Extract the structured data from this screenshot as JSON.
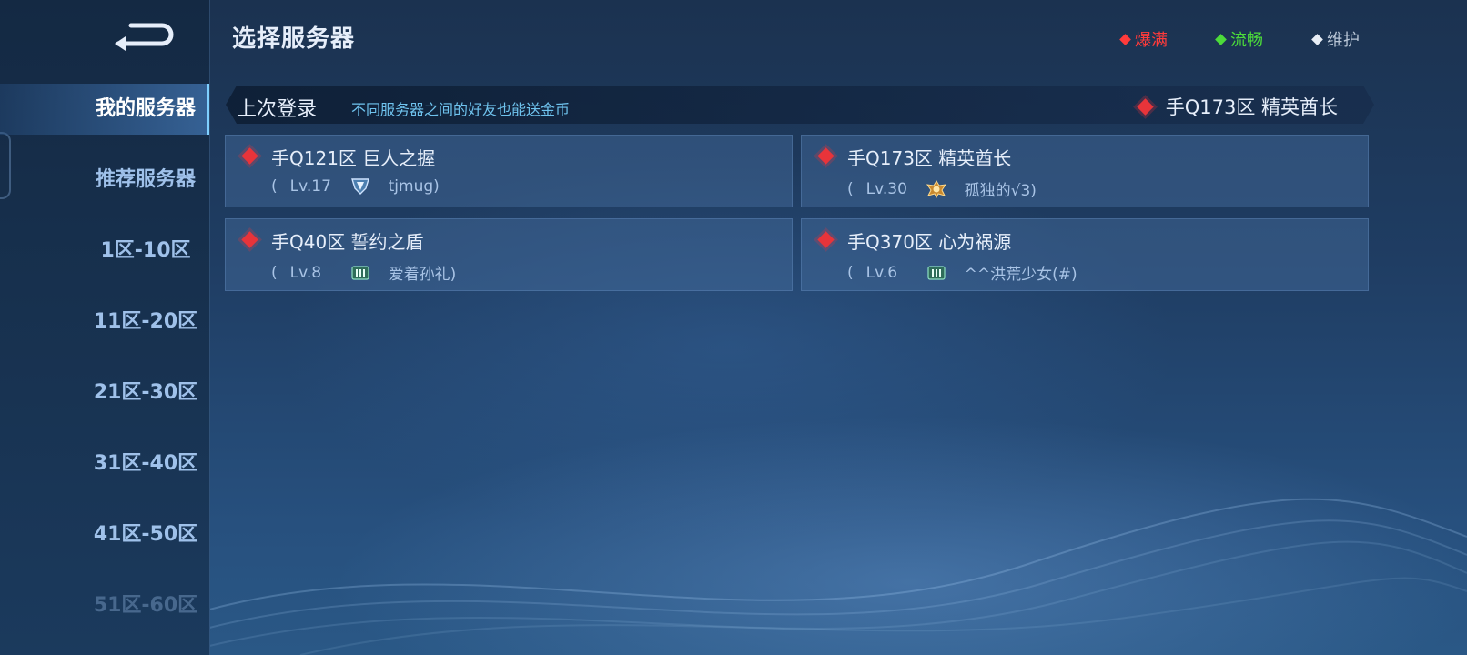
{
  "header": {
    "title": "选择服务器"
  },
  "legend": [
    {
      "label": "爆满",
      "color": "#ff3b3b"
    },
    {
      "label": "流畅",
      "color": "#4cdb3a"
    },
    {
      "label": "维护",
      "color": "#b9c6d6"
    }
  ],
  "sidebar": {
    "items": [
      {
        "label": "我的服务器"
      },
      {
        "label": "推荐服务器"
      },
      {
        "label": "1区-10区"
      },
      {
        "label": "11区-20区"
      },
      {
        "label": "21区-30区"
      },
      {
        "label": "31区-40区"
      },
      {
        "label": "41区-50区"
      },
      {
        "label": "51区-60区"
      }
    ]
  },
  "last_login": {
    "label": "上次登录",
    "hint": "不同服务器之间的好友也能送金币",
    "server": "手Q173区 精英酋长",
    "status_color": "#e8343a"
  },
  "servers": [
    {
      "name": "手Q121区 巨人之握",
      "open_paren": "(",
      "level": "Lv.17",
      "player": "tjmug)",
      "rank_icon": "rank-badge-diamond-icon"
    },
    {
      "name": "手Q173区 精英酋长",
      "open_paren": "(",
      "level": "Lv.30",
      "player": "孤独的√3)",
      "rank_icon": "rank-badge-gold-icon"
    },
    {
      "name": "手Q40区 誓约之盾",
      "open_paren": "(",
      "level": "Lv.8",
      "player": "爱着孙礼)",
      "rank_icon": "rank-badge-bronze-icon"
    },
    {
      "name": "手Q370区 心为祸源",
      "open_paren": "(",
      "level": "Lv.6",
      "player": "^^洪荒少女(#)",
      "rank_icon": "rank-badge-bronze-icon"
    }
  ]
}
